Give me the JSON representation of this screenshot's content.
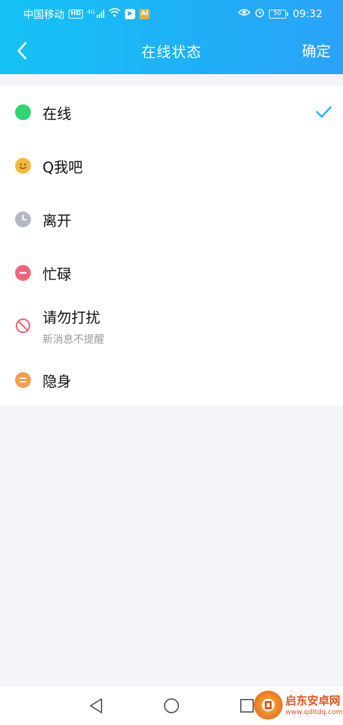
{
  "status_bar": {
    "carrier": "中国移动",
    "hd": "HD",
    "network": "4G",
    "app_badge": "AI",
    "battery": "50",
    "time": "09:32"
  },
  "nav": {
    "title": "在线状态",
    "confirm_label": "确定"
  },
  "statuses": [
    {
      "label": "在线",
      "icon": "online-dot-icon",
      "color": "#2fd571",
      "selected": true
    },
    {
      "label": "Q我吧",
      "icon": "smiley-icon",
      "color": "#f7b93b",
      "selected": false
    },
    {
      "label": "离开",
      "icon": "clock-icon",
      "color": "#b4b8c5",
      "selected": false
    },
    {
      "label": "忙碌",
      "icon": "minus-circle-icon",
      "color": "#f0637a",
      "selected": false
    },
    {
      "label": "请勿打扰",
      "sub": "新消息不提醒",
      "icon": "no-entry-icon",
      "color": "#f0637a",
      "selected": false
    },
    {
      "label": "隐身",
      "icon": "equals-circle-icon",
      "color": "#f4a04a",
      "selected": false
    }
  ],
  "accent_color": "#1fb0f7",
  "watermark": {
    "title": "启东安卓网",
    "url": "www.qdltdq.com"
  }
}
